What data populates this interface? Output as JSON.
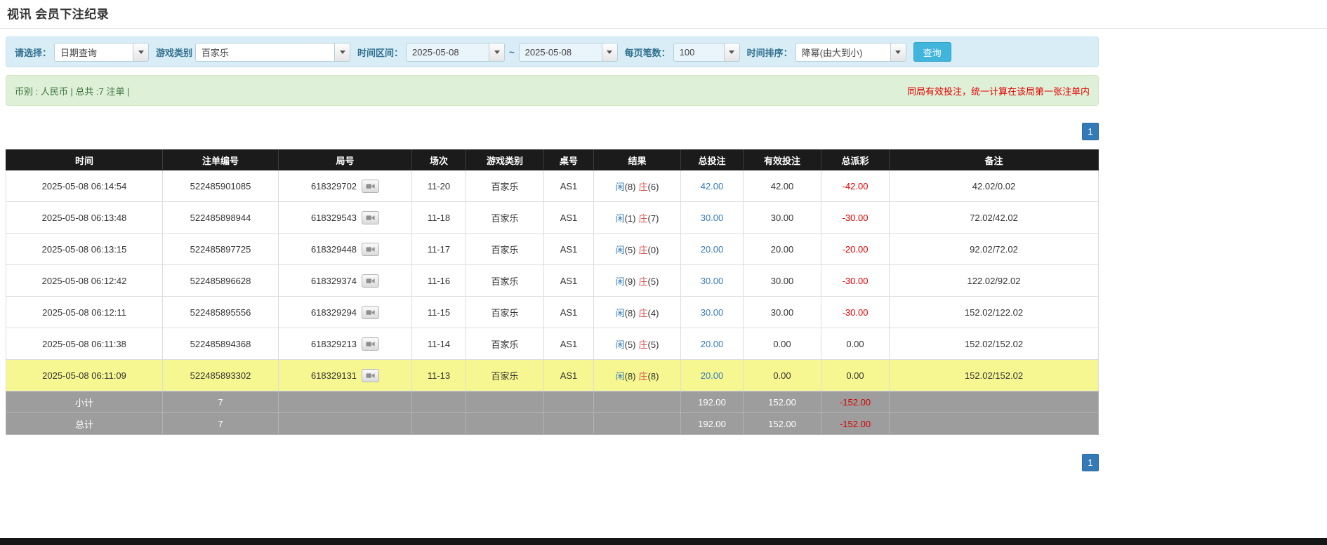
{
  "page": {
    "title": "视讯 会员下注纪录"
  },
  "filters": {
    "select_label": "请选择：",
    "select_value": "日期查询",
    "game_type_label": "游戏类别",
    "game_type_value": "百家乐",
    "time_range_label": "时间区间：",
    "date_from": "2025-05-08",
    "range_separator": "~",
    "date_to": "2025-05-08",
    "page_size_label": "每页笔数：",
    "page_size_value": "100",
    "sort_label": "时间排序：",
    "sort_value": "降幂(由大到小)",
    "search_button": "查询"
  },
  "summary": {
    "left": "币别 : 人民币 | 总共 :7 注单 |",
    "right": "同局有效投注，统一计算在该局第一张注单内"
  },
  "pagination": {
    "page": "1"
  },
  "colors": {
    "accent_blue": "#337ab7",
    "banker_red": "#d9534f",
    "negative_red": "#e00000",
    "highlight_yellow": "#f7f792",
    "header_black": "#1b1b1b",
    "footer_gray": "#9d9d9d"
  },
  "table": {
    "headers": [
      "时间",
      "注单编号",
      "局号",
      "场次",
      "游戏类别",
      "桌号",
      "结果",
      "总投注",
      "有效投注",
      "总派彩",
      "备注"
    ],
    "rows": [
      {
        "time": "2025-05-08 06:14:54",
        "bet_id": "522485901085",
        "round_id": "618329702",
        "session": "11-20",
        "game": "百家乐",
        "table_no": "AS1",
        "player": "闲",
        "player_score": "(8)",
        "banker": "庄",
        "banker_score": "(6)",
        "total_bet": "42.00",
        "valid_bet": "42.00",
        "payout": "-42.00",
        "remark": "42.02/0.02",
        "highlight": false
      },
      {
        "time": "2025-05-08 06:13:48",
        "bet_id": "522485898944",
        "round_id": "618329543",
        "session": "11-18",
        "game": "百家乐",
        "table_no": "AS1",
        "player": "闲",
        "player_score": "(1)",
        "banker": "庄",
        "banker_score": "(7)",
        "total_bet": "30.00",
        "valid_bet": "30.00",
        "payout": "-30.00",
        "remark": "72.02/42.02",
        "highlight": false
      },
      {
        "time": "2025-05-08 06:13:15",
        "bet_id": "522485897725",
        "round_id": "618329448",
        "session": "11-17",
        "game": "百家乐",
        "table_no": "AS1",
        "player": "闲",
        "player_score": "(5)",
        "banker": "庄",
        "banker_score": "(0)",
        "total_bet": "20.00",
        "valid_bet": "20.00",
        "payout": "-20.00",
        "remark": "92.02/72.02",
        "highlight": false
      },
      {
        "time": "2025-05-08 06:12:42",
        "bet_id": "522485896628",
        "round_id": "618329374",
        "session": "11-16",
        "game": "百家乐",
        "table_no": "AS1",
        "player": "闲",
        "player_score": "(9)",
        "banker": "庄",
        "banker_score": "(5)",
        "total_bet": "30.00",
        "valid_bet": "30.00",
        "payout": "-30.00",
        "remark": "122.02/92.02",
        "highlight": false
      },
      {
        "time": "2025-05-08 06:12:11",
        "bet_id": "522485895556",
        "round_id": "618329294",
        "session": "11-15",
        "game": "百家乐",
        "table_no": "AS1",
        "player": "闲",
        "player_score": "(8)",
        "banker": "庄",
        "banker_score": "(4)",
        "total_bet": "30.00",
        "valid_bet": "30.00",
        "payout": "-30.00",
        "remark": "152.02/122.02",
        "highlight": false
      },
      {
        "time": "2025-05-08 06:11:38",
        "bet_id": "522485894368",
        "round_id": "618329213",
        "session": "11-14",
        "game": "百家乐",
        "table_no": "AS1",
        "player": "闲",
        "player_score": "(5)",
        "banker": "庄",
        "banker_score": "(5)",
        "total_bet": "20.00",
        "valid_bet": "0.00",
        "payout": "0.00",
        "remark": "152.02/152.02",
        "highlight": false
      },
      {
        "time": "2025-05-08 06:11:09",
        "bet_id": "522485893302",
        "round_id": "618329131",
        "session": "11-13",
        "game": "百家乐",
        "table_no": "AS1",
        "player": "闲",
        "player_score": "(8)",
        "banker": "庄",
        "banker_score": "(8)",
        "total_bet": "20.00",
        "valid_bet": "0.00",
        "payout": "0.00",
        "remark": "152.02/152.02",
        "highlight": true
      }
    ],
    "subtotal": {
      "label": "小计",
      "count": "7",
      "total_bet": "192.00",
      "valid_bet": "152.00",
      "payout": "-152.00"
    },
    "total": {
      "label": "总计",
      "count": "7",
      "total_bet": "192.00",
      "valid_bet": "152.00",
      "payout": "-152.00"
    }
  }
}
